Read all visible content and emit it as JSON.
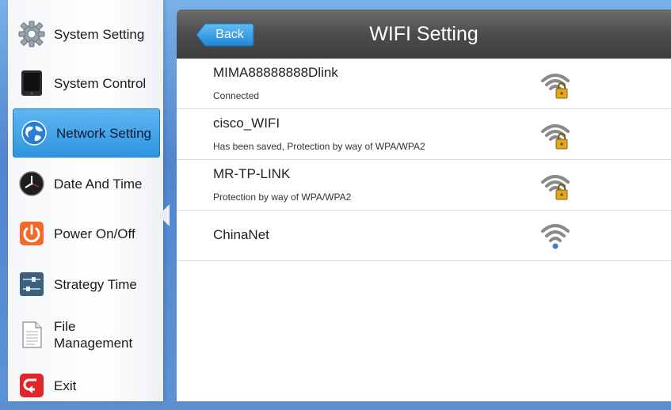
{
  "sidebar": {
    "items": [
      {
        "label": "System Setting",
        "icon": "gear-icon",
        "active": false
      },
      {
        "label": "System Control",
        "icon": "tablet-icon",
        "active": false
      },
      {
        "label": "Network Setting",
        "icon": "globe-icon",
        "active": true
      },
      {
        "label": "Date And Time",
        "icon": "clock-icon",
        "active": false
      },
      {
        "label": "Power On/Off",
        "icon": "power-icon",
        "active": false
      },
      {
        "label": "Strategy Time",
        "icon": "sliders-icon",
        "active": false
      },
      {
        "label": "File Management",
        "label_line1": "File",
        "label_line2": "Management",
        "icon": "document-icon",
        "active": false
      },
      {
        "label": "Exit",
        "icon": "exit-icon",
        "active": false
      }
    ]
  },
  "header": {
    "title": "WIFI Setting",
    "back_label": "Back"
  },
  "networks": [
    {
      "ssid": "MIMA88888888Dlink",
      "status": "Connected",
      "secured": true,
      "icon": "wifi-lock-icon"
    },
    {
      "ssid": "cisco_WIFI",
      "status": "Has been saved, Protection by way of WPA/WPA2",
      "secured": true,
      "icon": "wifi-lock-icon"
    },
    {
      "ssid": "MR-TP-LINK",
      "status": "Protection by way of WPA/WPA2",
      "secured": true,
      "icon": "wifi-lock-icon"
    },
    {
      "ssid": "ChinaNet",
      "status": "",
      "secured": false,
      "icon": "wifi-icon"
    }
  ],
  "colors": {
    "accent": "#2e94de",
    "topbar": "#4a4a4a",
    "backdrop": "#5b8fd0",
    "wifi": "#8a8a8a",
    "wifi_open": "#3a7fd0",
    "lock": "#d9a21a",
    "power": "#f06a2a",
    "exit": "#e0262a"
  }
}
